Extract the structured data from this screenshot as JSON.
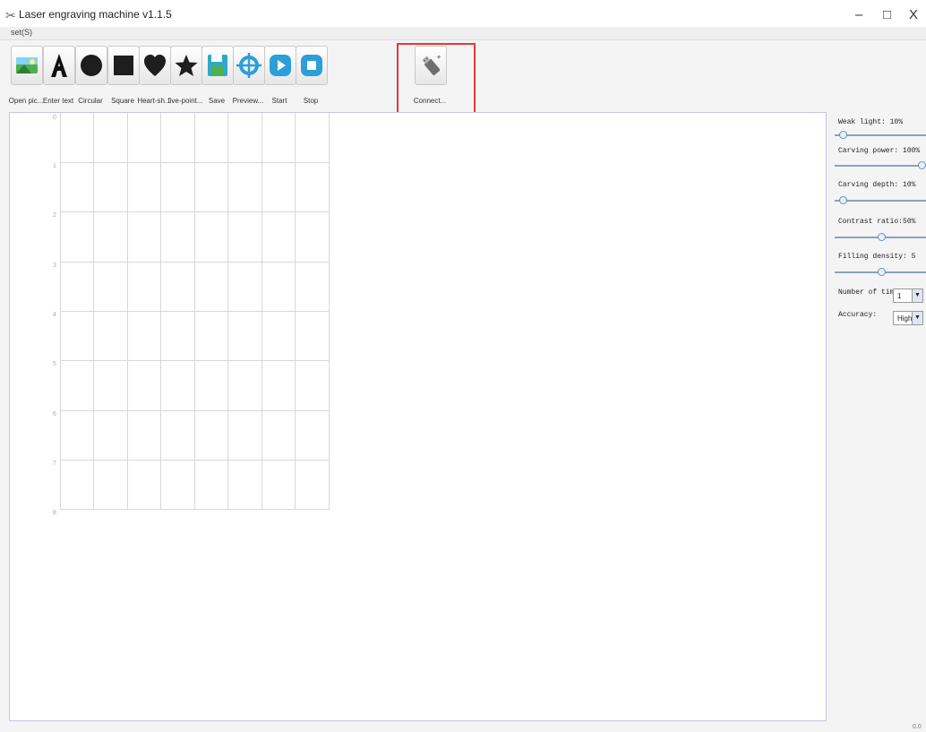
{
  "window": {
    "title": "Laser engraving machine v1.1.5",
    "app_icon": "scissors-icon",
    "minimize": "–",
    "maximize": "□",
    "close": "X"
  },
  "menu": {
    "items": [
      "set(S)"
    ]
  },
  "toolbar": {
    "tools": [
      {
        "label": "Open pic...",
        "icon": "open-picture-icon"
      },
      {
        "label": "Enter text",
        "icon": "text-icon"
      },
      {
        "label": "Circular",
        "icon": "circle-icon"
      },
      {
        "label": "Square",
        "icon": "square-icon"
      },
      {
        "label": "Heart-sh...",
        "icon": "heart-icon"
      },
      {
        "label": "five-point...",
        "icon": "star-icon"
      },
      {
        "label": "Save",
        "icon": "save-icon"
      },
      {
        "label": "Preview...",
        "icon": "crosshair-icon"
      },
      {
        "label": "Start",
        "icon": "play-icon"
      },
      {
        "label": "Stop",
        "icon": "stop-icon"
      }
    ],
    "connect": {
      "label": "Connect...",
      "icon": "usb-icon"
    }
  },
  "canvas": {
    "y_axis_labels": [
      "0",
      "1",
      "2",
      "3",
      "4",
      "5",
      "6",
      "7",
      "8"
    ]
  },
  "settings": {
    "weak_light": {
      "label": "Weak light: 10%",
      "value": 10
    },
    "carving_power": {
      "label": "Carving power: 100%",
      "value": 100
    },
    "carving_depth": {
      "label": "Carving depth: 10%",
      "value": 10
    },
    "contrast_ratio": {
      "label": "Contrast ratio:50%",
      "value": 50
    },
    "filling_density": {
      "label": "Filling density: 5",
      "value": 5
    },
    "number_of_times": {
      "label": "Number of times:",
      "value": "1"
    },
    "accuracy": {
      "label": "Accuracy:",
      "value": "High"
    }
  },
  "status": {
    "corner": "0.0"
  },
  "colors": {
    "highlight": "#e53935",
    "accent": "#2196f3",
    "canvas_border": "#c5c5e6"
  }
}
